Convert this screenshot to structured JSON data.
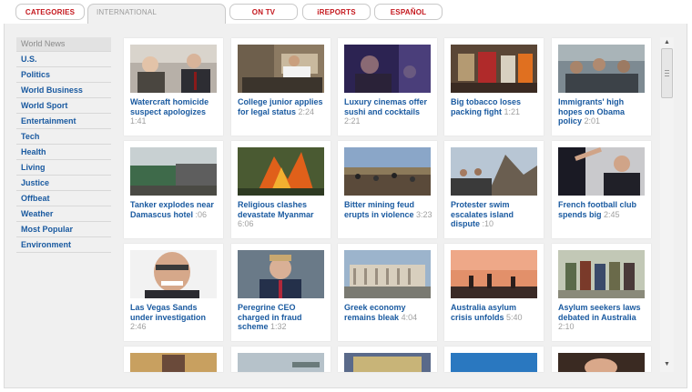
{
  "tabs": [
    {
      "label": "CATEGORIES"
    },
    {
      "label": "INTERNATIONAL"
    },
    {
      "label": "ON TV"
    },
    {
      "label": "iREPORTS"
    },
    {
      "label": "ESPAÑOL"
    }
  ],
  "sidebar": {
    "items": [
      {
        "label": "World News",
        "active": true
      },
      {
        "label": "U.S."
      },
      {
        "label": "Politics"
      },
      {
        "label": "World Business"
      },
      {
        "label": "World Sport"
      },
      {
        "label": "Entertainment"
      },
      {
        "label": "Tech"
      },
      {
        "label": "Health"
      },
      {
        "label": "Living"
      },
      {
        "label": "Justice"
      },
      {
        "label": "Offbeat"
      },
      {
        "label": "Weather"
      },
      {
        "label": "Most Popular"
      },
      {
        "label": "Environment"
      }
    ]
  },
  "videos": [
    {
      "title": "Watercraft homicide suspect apologizes",
      "duration": "1:41",
      "thumb": "two-men-suits"
    },
    {
      "title": "College junior applies for legal status",
      "duration": "2:24",
      "thumb": "student-at-desk"
    },
    {
      "title": "Luxury cinemas offer sushi and cocktails",
      "duration": "2:21",
      "thumb": "cinema-audience"
    },
    {
      "title": "Big tobacco loses packing fight",
      "duration": "1:21",
      "thumb": "cigarette-packs"
    },
    {
      "title": "Immigrants' high hopes on Obama policy",
      "duration": "2:01",
      "thumb": "crowd-room"
    },
    {
      "title": "Tanker explodes near Damascus hotel",
      "duration": ":06",
      "thumb": "tanker-fire"
    },
    {
      "title": "Religious clashes devastate Myanmar",
      "duration": "6:06",
      "thumb": "village-fire"
    },
    {
      "title": "Bitter mining feud erupts in violence",
      "duration": "3:23",
      "thumb": "crowd-field"
    },
    {
      "title": "Protester swim escalates island dispute",
      "duration": ":10",
      "thumb": "island-rocks"
    },
    {
      "title": "French football club spends big",
      "duration": "2:45",
      "thumb": "coach-pointing"
    },
    {
      "title": "Las Vegas Sands under investigation",
      "duration": "2:46",
      "thumb": "smiling-man"
    },
    {
      "title": "Peregrine CEO charged in fraud scheme",
      "duration": "1:32",
      "thumb": "man-in-suit"
    },
    {
      "title": "Greek economy remains bleak",
      "duration": "4:04",
      "thumb": "parliament-building"
    },
    {
      "title": "Australia asylum crisis unfolds",
      "duration": "5:40",
      "thumb": "sunset-people"
    },
    {
      "title": "Asylum seekers laws debated in Australia",
      "duration": "2:10",
      "thumb": "group-standing"
    },
    {
      "title": "",
      "duration": "",
      "thumb": "person-portrait"
    },
    {
      "title": "",
      "duration": "",
      "thumb": "ship-water"
    },
    {
      "title": "",
      "duration": "",
      "thumb": "crowd-market"
    },
    {
      "title": "",
      "duration": "",
      "thumb": "blue-sky"
    },
    {
      "title": "",
      "duration": "",
      "thumb": "woman-portrait"
    }
  ],
  "colors": {
    "link": "#1a5aa0",
    "tab_text": "#c4161c",
    "duration": "#a0a0a0",
    "panel": "#f0f0f0"
  }
}
